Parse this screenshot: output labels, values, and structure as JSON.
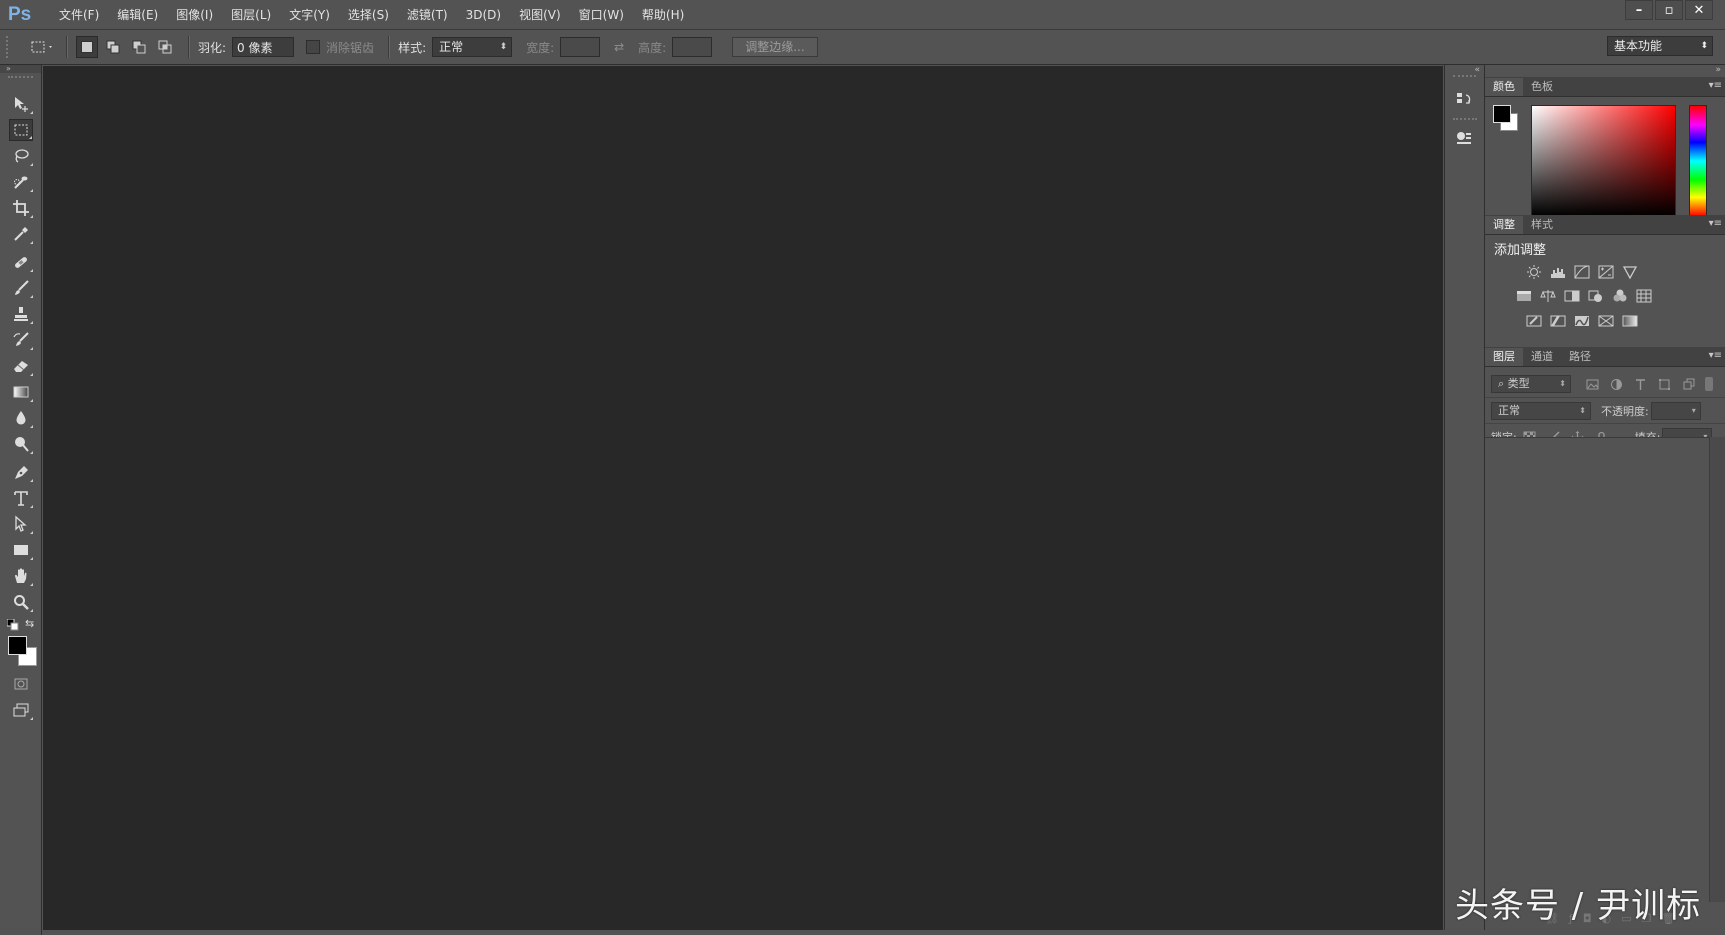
{
  "app": {
    "logo": "Ps"
  },
  "menu": [
    "文件(F)",
    "编辑(E)",
    "图像(I)",
    "图层(L)",
    "文字(Y)",
    "选择(S)",
    "滤镜(T)",
    "3D(D)",
    "视图(V)",
    "窗口(W)",
    "帮助(H)"
  ],
  "options": {
    "feather_label": "羽化:",
    "feather_value": "0 像素",
    "antialias_label": "消除锯齿",
    "style_label": "样式:",
    "style_value": "正常",
    "width_label": "宽度:",
    "height_label": "高度:",
    "refine_edge": "调整边缘...",
    "workspace": "基本功能"
  },
  "tools": [
    "move-tool",
    "rectangular-marquee-tool",
    "lasso-tool",
    "quick-selection-tool",
    "crop-tool",
    "eyedropper-tool",
    "spot-healing-brush-tool",
    "brush-tool",
    "clone-stamp-tool",
    "history-brush-tool",
    "eraser-tool",
    "gradient-tool",
    "blur-tool",
    "dodge-tool",
    "pen-tool",
    "type-tool",
    "path-selection-tool",
    "rectangle-tool",
    "hand-tool",
    "zoom-tool"
  ],
  "colors": {
    "foreground": "#000000",
    "background": "#ffffff",
    "canvas": "#282828",
    "ui": "#535353",
    "logo": "#7fb3e6"
  },
  "panels": {
    "color_tabs": [
      "颜色",
      "色板"
    ],
    "adjust_tabs": [
      "调整",
      "样式"
    ],
    "adjust_title": "添加调整",
    "layers_tabs": [
      "图层",
      "通道",
      "路径"
    ],
    "layer_filter": "类型",
    "blend_mode": "正常",
    "opacity_label": "不透明度:",
    "lock_label": "锁定:",
    "fill_label": "填充:"
  },
  "watermark": "头条号 / 尹训标"
}
